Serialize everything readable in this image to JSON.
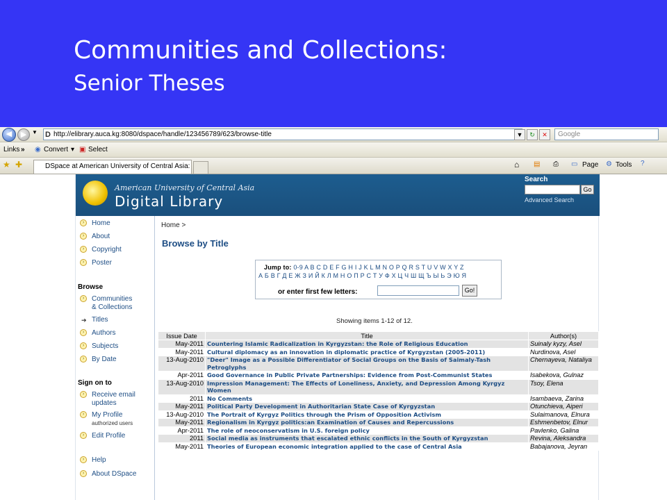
{
  "slide": {
    "title": "Communities and Collections:",
    "subtitle": "Senior Theses"
  },
  "browser": {
    "url": "http://elibrary.auca.kg:8080/dspace/handle/123456789/623/browse-title",
    "search_placeholder": "Google",
    "links_label": "Links",
    "convert_label": "Convert",
    "select_label": "Select",
    "tab_title": "DSpace at American University of Central Asia: Brows...",
    "page_label": "Page",
    "tools_label": "Tools",
    "icons": [
      "back-icon",
      "forward-icon",
      "refresh-icon",
      "stop-icon",
      "favorites-star-icon",
      "add-favorites-icon",
      "home-icon",
      "feeds-icon",
      "print-icon",
      "help-icon"
    ]
  },
  "site": {
    "university": "American University of Central Asia",
    "library": "Digital Library",
    "search_label": "Search",
    "search_go": "Go",
    "advanced_search": "Advanced Search"
  },
  "sidebar": {
    "top_items": [
      {
        "label": "Home"
      },
      {
        "label": "About"
      },
      {
        "label": "Copyright"
      },
      {
        "label": "Poster"
      }
    ],
    "browse_heading": "Browse",
    "browse_items": [
      {
        "label": "Communities",
        "label2": "& Collections"
      },
      {
        "label": "Titles"
      },
      {
        "label": "Authors"
      },
      {
        "label": "Subjects"
      },
      {
        "label": "By Date"
      }
    ],
    "signon_heading": "Sign on to",
    "signon_items": [
      {
        "label": "Receive email",
        "label2": "updates"
      },
      {
        "label": "My Profile",
        "label2": "authorized users"
      },
      {
        "label": "Edit Profile"
      }
    ],
    "bottom_items": [
      {
        "label": "Help"
      },
      {
        "label": "About DSpace"
      }
    ]
  },
  "content": {
    "breadcrumb": "Home >",
    "heading": "Browse by Title",
    "jump_label": "Jump to:",
    "jump_latin": "0-9 A B C D E F G H I J K L M N O P Q R S T U V W X Y Z",
    "jump_cyrillic": "А Б В Г Д Е Ж З И Й К Л М Н О П Р С Т У Ф Х Ц Ч Ш Щ Ъ Ы Ь Э Ю Я",
    "enter_label": "or enter first few letters:",
    "go_label": "Go!",
    "showing": "Showing items 1-12 of 12.",
    "columns": [
      "Issue Date",
      "Title",
      "Author(s)"
    ],
    "rows": [
      {
        "date": "May-2011",
        "title": "Countering Islamic Radicalization in Kyrgyzstan: the Role of Religious Education",
        "author": "Suinaly kyzy, Asel"
      },
      {
        "date": "May-2011",
        "title": "Cultural diplomacy as an innovation in diplomatic practice of Kyrgyzstan (2005-2011)",
        "author": "Nurdinova, Asel"
      },
      {
        "date": "13-Aug-2010",
        "title": "\"Deer\" Image as a Possible Differentiator of Social Groups on the Basis of Saimaly-Tash Petroglyphs",
        "author": "Chernayeva, Nataliya"
      },
      {
        "date": "Apr-2011",
        "title": "Good Governance in Public Private Partnerships: Evidence from Post-Communist States",
        "author": "Isabekova, Gulnaz"
      },
      {
        "date": "13-Aug-2010",
        "title": "Impression Management: The Effects of Loneliness, Anxiety, and Depression Among Kyrgyz Women",
        "author": "Tsoy, Elena"
      },
      {
        "date": "2011",
        "title": "No Comments",
        "author": "Isambaeva, Zarina"
      },
      {
        "date": "May-2011",
        "title": "Political Party Development in Authoritarian State Case of Kyrgyzstan",
        "author": "Otunchieva, Aiperi"
      },
      {
        "date": "13-Aug-2010",
        "title": "The Portrait of Kyrgyz Politics through the Prism of Opposition Activism",
        "author": "Sulaimanova, Elnura"
      },
      {
        "date": "May-2011",
        "title": "Regionalism in Kyrgyz politics:an Examination of Causes and Repercussions",
        "author": "Eshmenbetov, Elnur"
      },
      {
        "date": "Apr-2011",
        "title": "The role of neoconservatism in U.S. foreign policy",
        "author": "Pavlenko, Galina"
      },
      {
        "date": "2011",
        "title": "Social media as instruments that escalated ethnic conflicts in the South of Kyrgyzstan",
        "author": "Revina, Aleksandra"
      },
      {
        "date": "May-2011",
        "title": "Theories of European economic integration applied to the case of Central Asia",
        "author": "Babajanova, Jeyran"
      }
    ]
  }
}
